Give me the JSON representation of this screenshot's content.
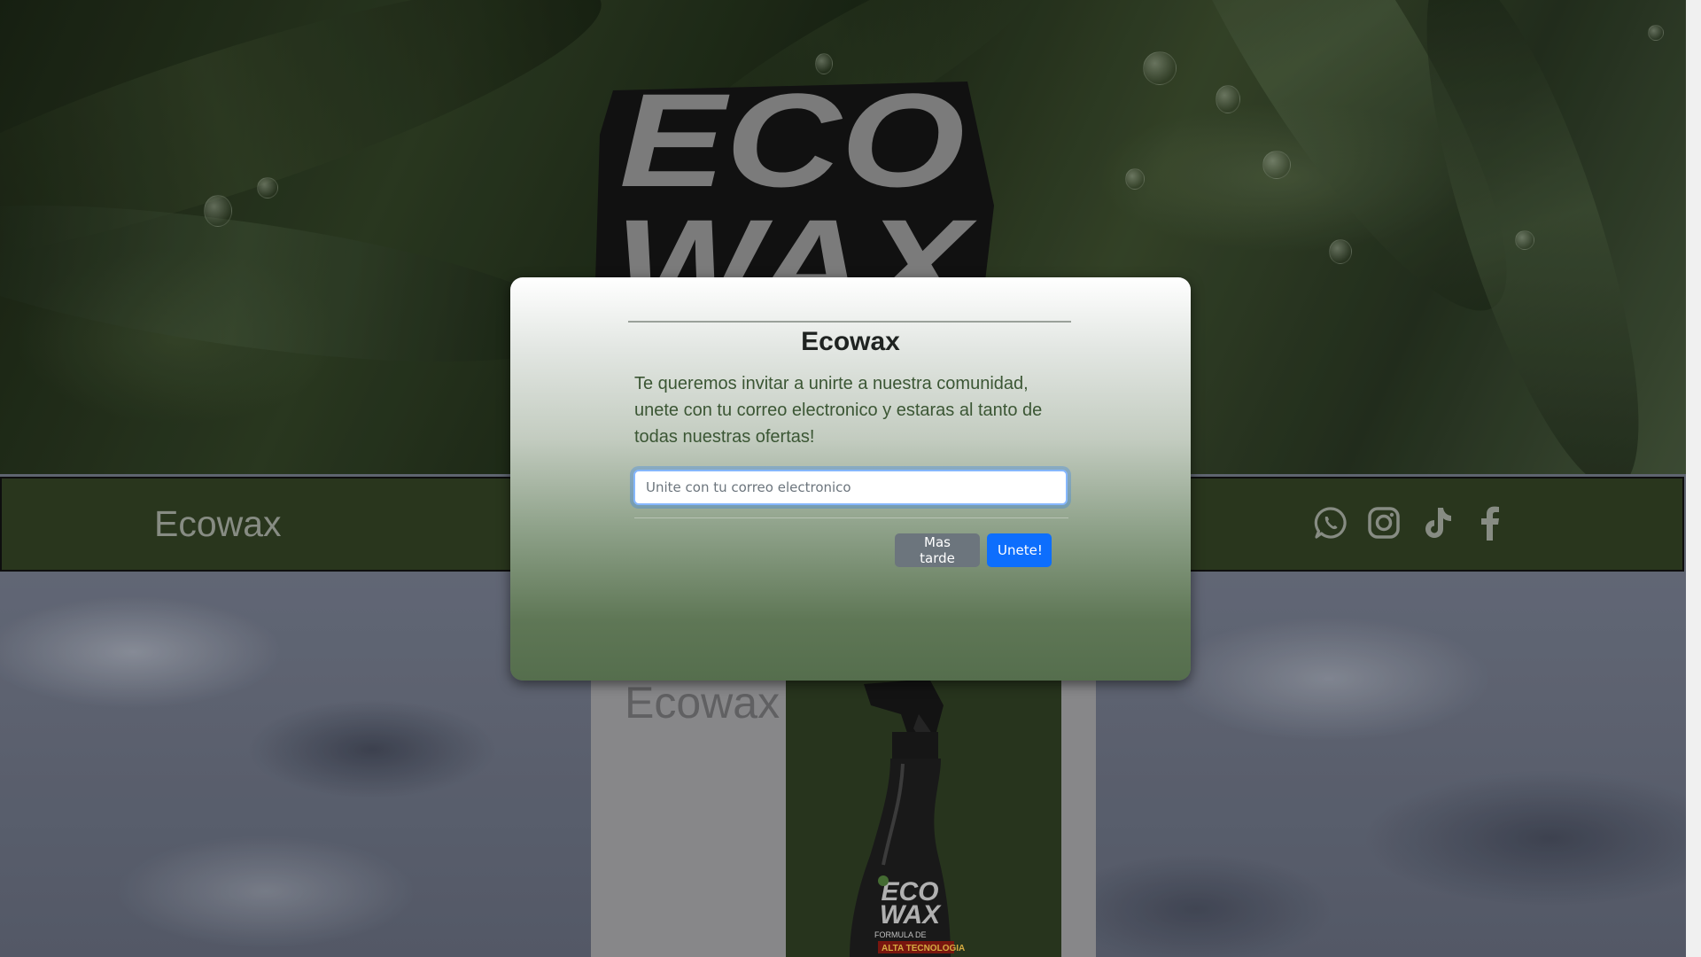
{
  "logo": {
    "line1": "ECO",
    "line2": "WAX"
  },
  "navbar": {
    "brand": "Ecowax",
    "social": [
      {
        "icon": "whatsapp-icon"
      },
      {
        "icon": "instagram-icon"
      },
      {
        "icon": "tiktok-icon"
      },
      {
        "icon": "facebook-icon"
      }
    ]
  },
  "section": {
    "title": "Ecowax",
    "product": {
      "brand_line1": "ECO",
      "brand_line2": "WAX",
      "tagline1": "FORMULA DE",
      "tagline2": "ALTA TECNOLOGIA"
    }
  },
  "modal": {
    "title": "Ecowax",
    "text": "Te queremos invitar a unirte a nuestra comunidad, unete con tu correo electronico y estaras al tanto de todas nuestras ofertas!",
    "email_placeholder": "Unite con tu correo electronico",
    "email_value": "",
    "later_label": "Mas tarde",
    "join_label": "Unete!"
  },
  "colors": {
    "navbar_bg": "#2f3e22",
    "primary_button": "#0d6efd",
    "secondary_button": "#6c757d",
    "modal_text": "#3b5634"
  }
}
